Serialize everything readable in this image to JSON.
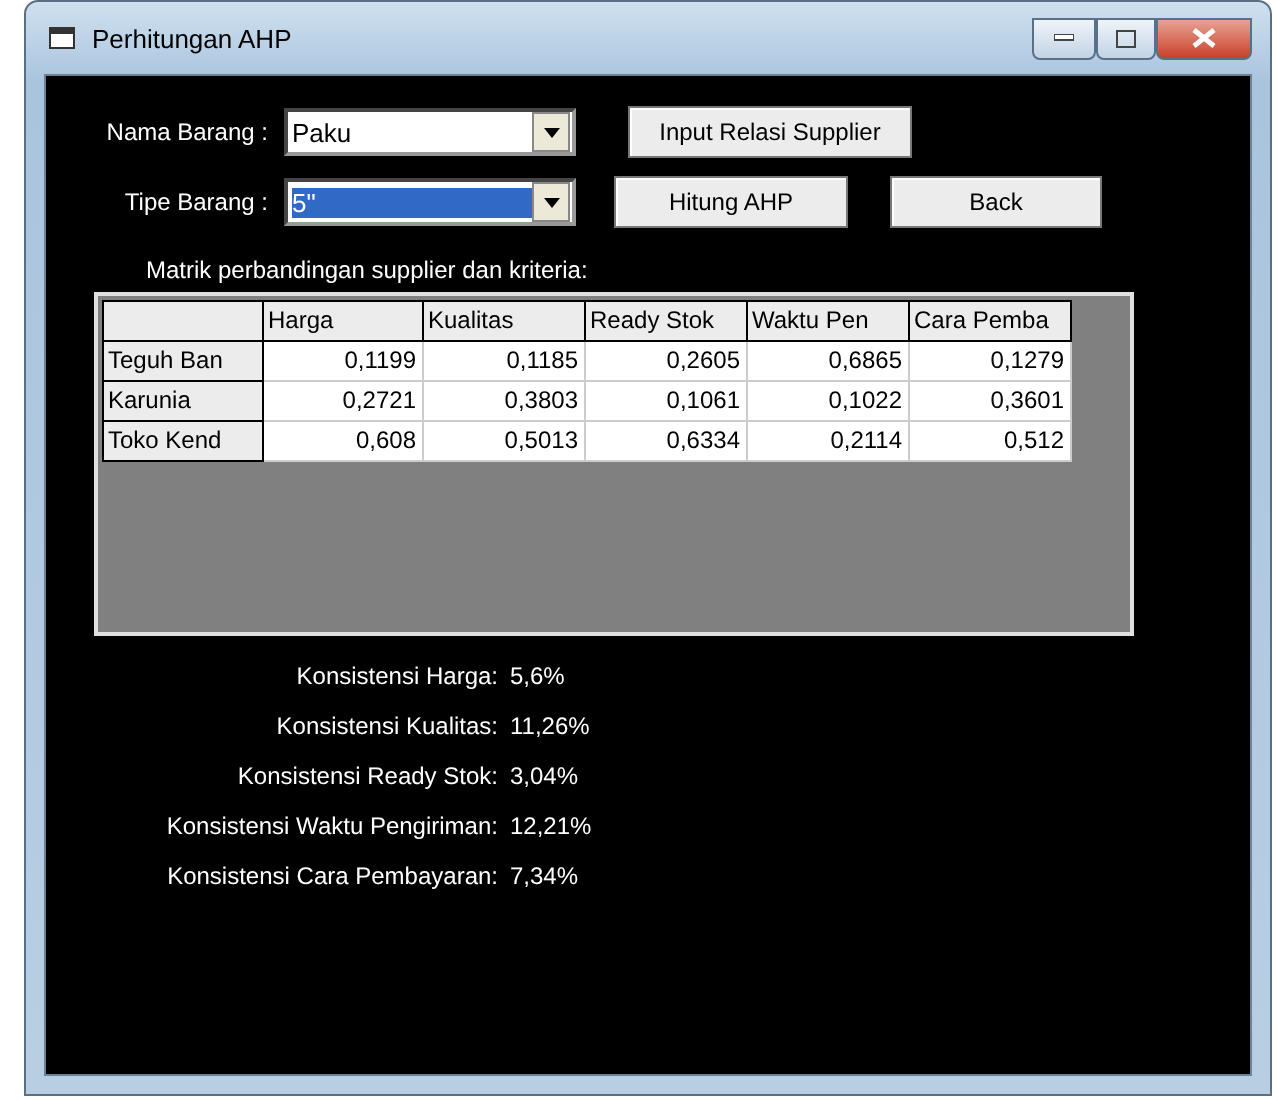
{
  "window": {
    "title": "Perhitungan AHP"
  },
  "fields": [
    {
      "label": "Nama Barang :",
      "value": "Paku",
      "text_selected": false
    },
    {
      "label": "Tipe Barang :",
      "value": "5\"",
      "text_selected": true
    }
  ],
  "buttons": [
    {
      "label": "Input Relasi Supplier"
    },
    {
      "label": "Hitung AHP"
    },
    {
      "label": "Back"
    }
  ],
  "matrix": {
    "caption": "Matrik perbandingan supplier dan kriteria:",
    "columns": [
      "Harga",
      "Kualitas",
      "Ready Stok",
      "Waktu Pen",
      "Cara Pemba"
    ],
    "rows": [
      {
        "name": "Teguh Ban",
        "values": [
          "0,1199",
          "0,1185",
          "0,2605",
          "0,6865",
          "0,1279"
        ]
      },
      {
        "name": "Karunia",
        "values": [
          "0,2721",
          "0,3803",
          "0,1061",
          "0,1022",
          "0,3601"
        ]
      },
      {
        "name": "Toko Kend",
        "values": [
          "0,608",
          "0,5013",
          "0,6334",
          "0,2114",
          "0,512"
        ]
      }
    ]
  },
  "consistency": [
    {
      "label": "Konsistensi Harga:",
      "value": "5,6%"
    },
    {
      "label": "Konsistensi Kualitas:",
      "value": "11,26%"
    },
    {
      "label": "Konsistensi Ready Stok:",
      "value": "3,04%"
    },
    {
      "label": "Konsistensi Waktu Pengiriman:",
      "value": "12,21%"
    },
    {
      "label": "Konsistensi Cara Pembayaran:",
      "value": "7,34%"
    }
  ]
}
